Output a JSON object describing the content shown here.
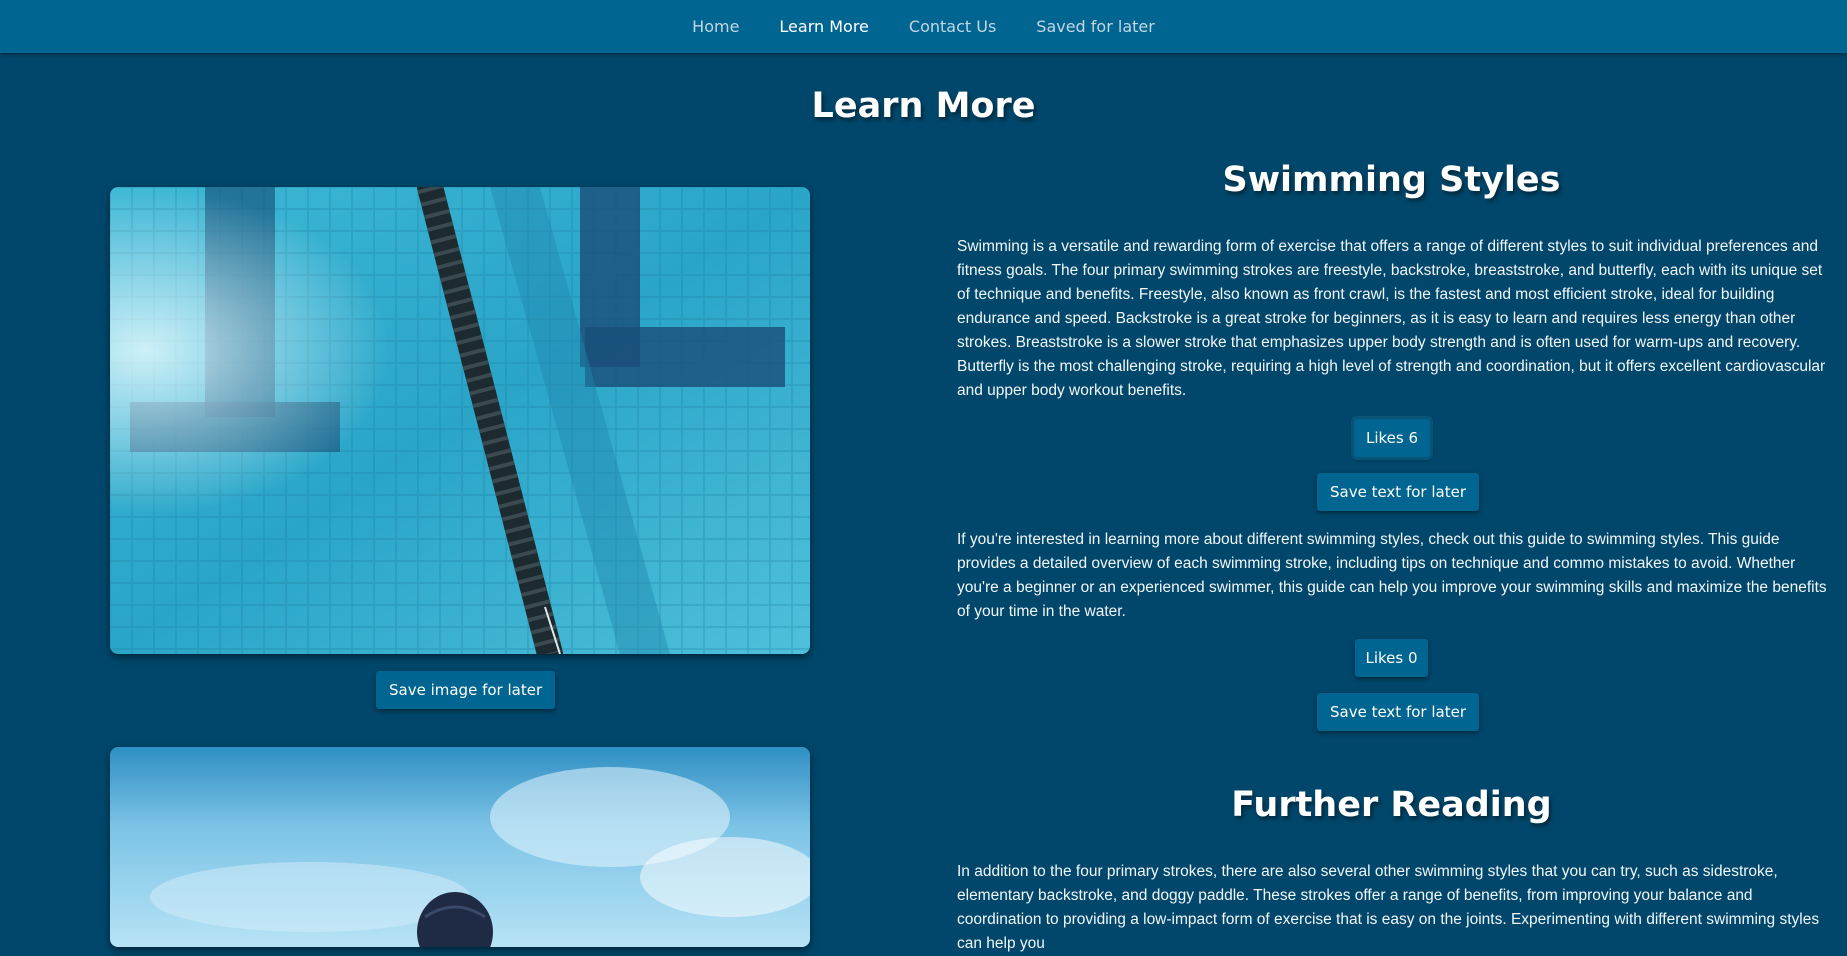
{
  "nav": {
    "items": [
      {
        "label": "Home"
      },
      {
        "label": "Learn More",
        "active": true
      },
      {
        "label": "Contact Us"
      },
      {
        "label": "Saved for later"
      }
    ]
  },
  "page": {
    "title": "Learn More"
  },
  "images": [
    {
      "alt_icon": "pool-lane-photo",
      "save_label": "Save image for later"
    },
    {
      "alt_icon": "swimmer-photo"
    }
  ],
  "sections": [
    {
      "title": "Swimming Styles",
      "paragraphs": [
        {
          "text": "Swimming is a versatile and rewarding form of exercise that offers a range of different styles to suit individual preferences and fitness goals. The four primary swimming strokes are freestyle, backstroke, breaststroke, and butterfly, each with its unique set of technique and benefits. Freestyle, also known as front crawl, is the fastest and most efficient stroke, ideal for building endurance and speed. Backstroke is a great stroke for beginners, as it is easy to learn and requires less energy than other strokes. Breaststroke is a slower stroke that emphasizes upper body strength and is often used for warm-ups and recovery. Butterfly is the most challenging stroke, requiring a high level of strength and coordination, but it offers excellent cardiovascular and upper body workout benefits.",
          "likes_label": "Likes 6",
          "save_label": "Save text for later"
        },
        {
          "text": "If you're interested in learning more about different swimming styles, check out this guide to swimming styles. This guide provides a detailed overview of each swimming stroke, including tips on technique and commo mistakes to avoid. Whether you're a beginner or an experienced swimmer, this guide can help you improve your swimming skills and maximize the benefits of your time in the water.",
          "likes_label": "Likes 0",
          "save_label": "Save text for later"
        }
      ]
    },
    {
      "title": "Further Reading",
      "paragraphs": [
        {
          "text": "In addition to the four primary strokes, there are also several other swimming styles that you can try, such as sidestroke, elementary backstroke, and doggy paddle. These strokes offer a range of benefits, from improving your balance and coordination to providing a low-impact form of exercise that is easy on the joints. Experimenting with different swimming styles can help you"
        }
      ]
    }
  ],
  "colors": {
    "background": "#00476b",
    "navbar": "#006591",
    "button": "#006591"
  }
}
